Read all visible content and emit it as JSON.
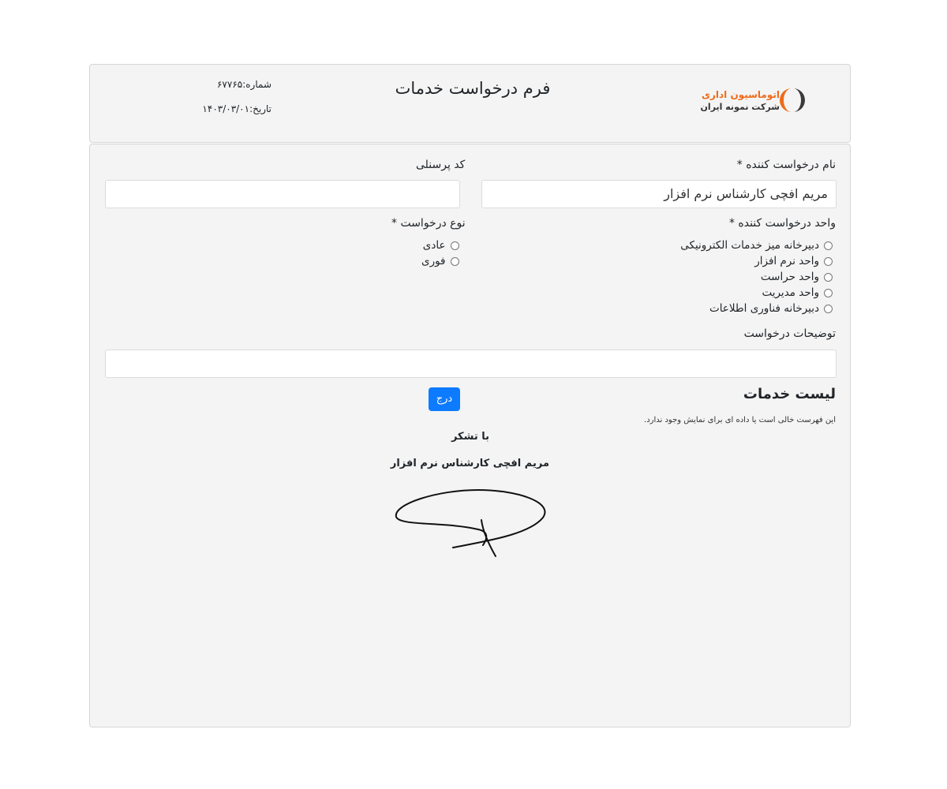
{
  "header": {
    "logo": {
      "line1": "اتوماسیون اداری",
      "line2": "شرکت نمونه ایران",
      "accent": "#ee6b1a"
    },
    "title": "فرم درخواست خدمات",
    "number": "شماره:۶۷۷۶۵",
    "date": "تاریخ:۱۴۰۳/۰۳/۰۱"
  },
  "form": {
    "requester_name": {
      "label": "نام درخواست کننده *",
      "value": "مریم افچی کارشناس نرم افزار"
    },
    "personnel_code": {
      "label": "کد پرسنلی",
      "value": ""
    },
    "requester_unit": {
      "label": "واحد درخواست کننده *",
      "options": [
        "دبیرخانه میز خدمات الکترونیکی",
        "واحد نرم افزار",
        "واحد حراست",
        "واحد مدیریت",
        "دبیرخانه فناوری اطلاعات"
      ]
    },
    "request_type": {
      "label": "نوع درخواست *",
      "options": [
        "عادی",
        "فوری"
      ]
    },
    "description": {
      "label": "توضیحات درخواست",
      "value": ""
    }
  },
  "services": {
    "title": "لیست خدمات",
    "empty_message": "این فهرست خالی است یا داده ای برای نمایش وجود ندارد.",
    "insert_label": "درج"
  },
  "closing": {
    "thanks": "با تشکر",
    "signer": "مریم افچی کارشناس نرم افزار",
    "signature_icon": "handwritten-signature"
  },
  "colors": {
    "primary_button": "#0d7bff",
    "panel_bg": "#f4f4f4"
  }
}
